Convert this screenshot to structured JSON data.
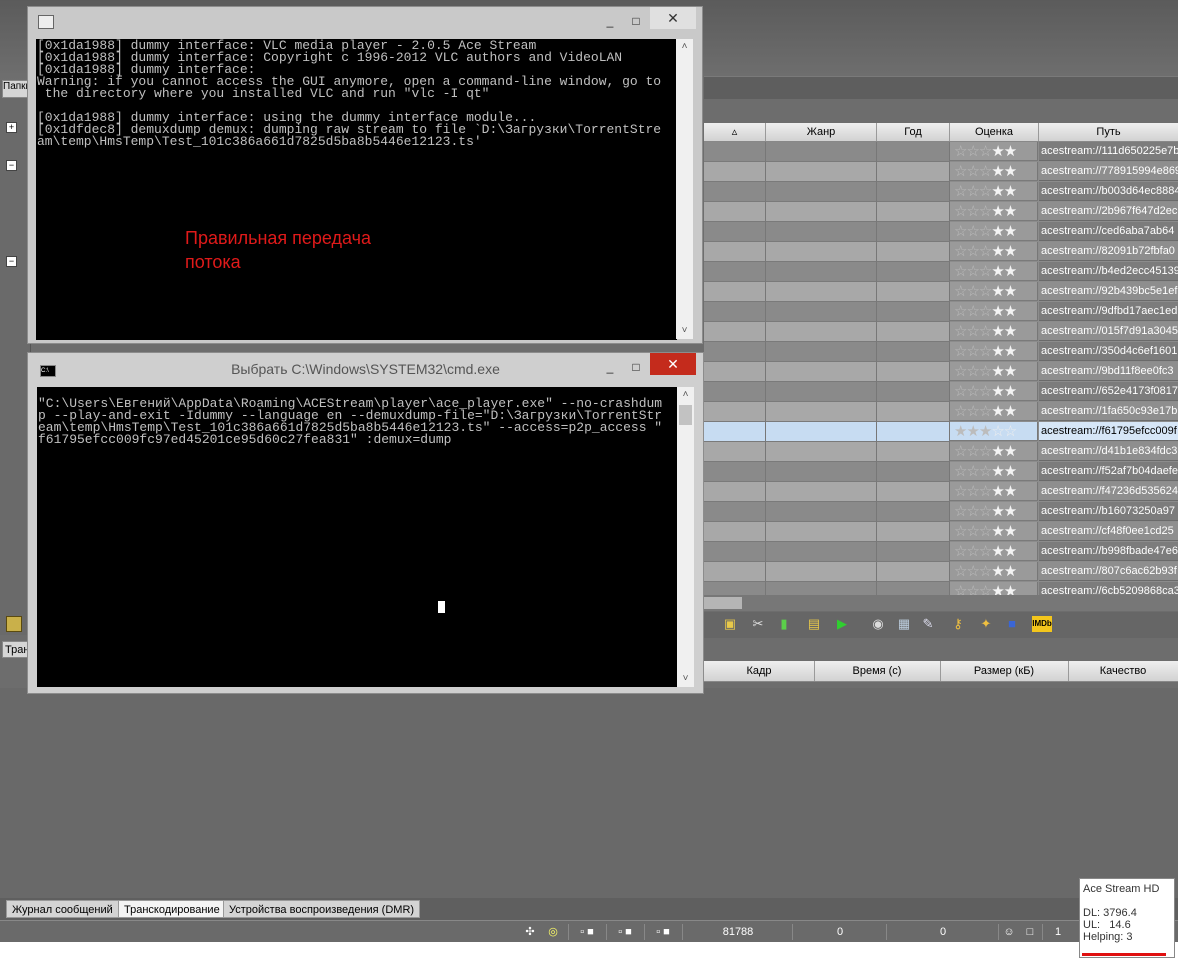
{
  "vlc_window": {
    "lines": [
      "[0x1da1988] dummy interface: VLC media player - 2.0.5 Ace Stream",
      "[0x1da1988] dummy interface: Copyright c 1996-2012 VLC authors and VideoLAN",
      "[0x1da1988] dummy interface:",
      "Warning: if you cannot access the GUI anymore, open a command-line window, go to",
      " the directory where you installed VLC and run \"vlc -I qt\"",
      "",
      "[0x1da1988] dummy interface: using the dummy interface module...",
      "[0x1dfdec8] demuxdump demux: dumping raw stream to file `D:\\Загрузки\\TorrentStre",
      "am\\temp\\HmsTemp\\Test_101c386a661d7825d5ba8b5446e12123.ts'"
    ],
    "annotation_line1": "Правильная передача",
    "annotation_line2": "потока",
    "minimize": "_",
    "maximize": "□",
    "close": "✕"
  },
  "cmd_window": {
    "title": "Выбрать C:\\Windows\\SYSTEM32\\cmd.exe",
    "lines": [
      "\"C:\\Users\\Евгений\\AppData\\Roaming\\ACEStream\\player\\ace_player.exe\" --no-crashdum",
      "p --play-and-exit -Idummy --language en --demuxdump-file=\"D:\\Загрузки\\TorrentStr",
      "eam\\temp\\HmsTemp\\Test_101c386a661d7825d5ba8b5446e12123.ts\" --access=p2p_access \"",
      "f61795efcc009fc97ed45201ce95d60c27fea831\" :demux=dump"
    ],
    "minimize": "_",
    "maximize": "□",
    "close": "✕"
  },
  "left_panel": {
    "tab_label": "Папки",
    "tran_tab_label": "Тран"
  },
  "grid": {
    "columns": {
      "genre": "Жанр",
      "year": "Год",
      "rating": "Оценка",
      "path": "Путь"
    },
    "rows": [
      {
        "path": "acestream://111d650225e7b"
      },
      {
        "path": "acestream://778915994e869"
      },
      {
        "path": "acestream://b003d64ec8884"
      },
      {
        "path": "acestream://2b967f647d2ec"
      },
      {
        "path": "acestream://ced6aba7ab64"
      },
      {
        "path": "acestream://82091b72fbfa0"
      },
      {
        "path": "acestream://b4ed2ecc45139"
      },
      {
        "path": "acestream://92b439bc5e1ef"
      },
      {
        "path": "acestream://9dfbd17aec1ed"
      },
      {
        "path": "acestream://015f7d91a3045"
      },
      {
        "path": "acestream://350d4c6ef1601"
      },
      {
        "path": "acestream://9bd11f8ee0fc3"
      },
      {
        "path": "acestream://652e4173f0817"
      },
      {
        "path": "acestream://1fa650c93e17b"
      },
      {
        "path": "acestream://f61795efcc009f"
      },
      {
        "path": "acestream://d41b1e834fdc3"
      },
      {
        "path": "acestream://f52af7b04daefe"
      },
      {
        "path": "acestream://f47236d535624"
      },
      {
        "path": "acestream://b16073250a97"
      },
      {
        "path": "acestream://cf48f0ee1cd25"
      },
      {
        "path": "acestream://b998fbade47e6"
      },
      {
        "path": "acestream://807c6ac62b93f"
      },
      {
        "path": "acestream://6cb5209868ca3"
      }
    ],
    "selected_index": 14
  },
  "lower_grid": {
    "columns": {
      "frame": "Кадр",
      "time": "Время (с)",
      "size": "Размер (кБ)",
      "quality": "Качество"
    }
  },
  "bottom_tabs": [
    {
      "label": "Журнал сообщений"
    },
    {
      "label": "Транскодирование"
    },
    {
      "label": "Устройства воспроизведения (DMR)"
    }
  ],
  "statusbar": {
    "value1": "81788",
    "value2": "0",
    "value3": "0",
    "value4": "1"
  },
  "tooltip": {
    "title": "Ace Stream HD",
    "dl": "DL: 3796.4",
    "ul": "UL:   14.6",
    "helping": "Helping: 3"
  },
  "colors": {
    "annotation": "#e01a1a",
    "selection": "#c7dcf2",
    "close_red": "#c42b1c"
  }
}
